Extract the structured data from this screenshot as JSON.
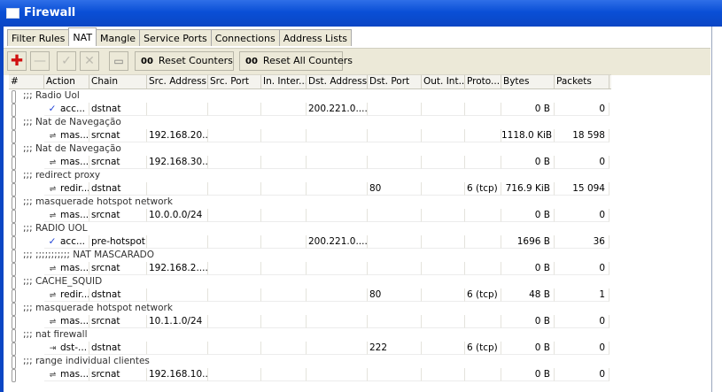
{
  "window": {
    "title": "Firewall"
  },
  "tabs": [
    "Filter Rules",
    "NAT",
    "Mangle",
    "Service Ports",
    "Connections",
    "Address Lists"
  ],
  "active_tab": "NAT",
  "toolbar": {
    "reset_counters": "Reset Counters",
    "reset_all_counters": "Reset All Counters",
    "counter_glyph": "00"
  },
  "columns": [
    "#",
    "Action",
    "Chain",
    "Src. Address",
    "Src. Port",
    "In. Inter...",
    "Dst. Address",
    "Dst. Port",
    "Out. Int...",
    "Proto...",
    "Bytes",
    "Packets"
  ],
  "rows": [
    {
      "comment": ";;; Radio Uol"
    },
    {
      "action_icon": "accept-icon",
      "action": "acc...",
      "chain": "dstnat",
      "src": "",
      "src_port": "",
      "in": "",
      "dst": "200.221.0....",
      "dst_port": "",
      "out": "",
      "proto": "",
      "bytes": "0 B",
      "packets": "0"
    },
    {
      "comment": ";;; Nat de Navegação"
    },
    {
      "action_icon": "masquerade-icon",
      "action": "mas...",
      "chain": "srcnat",
      "src": "192.168.20...",
      "src_port": "",
      "in": "",
      "dst": "",
      "dst_port": "",
      "out": "",
      "proto": "",
      "bytes": "1118.0 KiB",
      "packets": "18 598"
    },
    {
      "comment": ";;; Nat de Navegação"
    },
    {
      "action_icon": "masquerade-icon",
      "action": "mas...",
      "chain": "srcnat",
      "src": "192.168.30...",
      "src_port": "",
      "in": "",
      "dst": "",
      "dst_port": "",
      "out": "",
      "proto": "",
      "bytes": "0 B",
      "packets": "0"
    },
    {
      "comment": ";;; redirect proxy"
    },
    {
      "action_icon": "masquerade-icon",
      "action": "redir...",
      "chain": "dstnat",
      "src": "",
      "src_port": "",
      "in": "",
      "dst": "",
      "dst_port": "80",
      "out": "",
      "proto": "6 (tcp)",
      "bytes": "716.9 KiB",
      "packets": "15 094"
    },
    {
      "comment": ";;; masquerade hotspot network"
    },
    {
      "action_icon": "masquerade-icon",
      "action": "mas...",
      "chain": "srcnat",
      "src": "10.0.0.0/24",
      "src_port": "",
      "in": "",
      "dst": "",
      "dst_port": "",
      "out": "",
      "proto": "",
      "bytes": "0 B",
      "packets": "0"
    },
    {
      "comment": ";;; RADIO UOL"
    },
    {
      "action_icon": "accept-icon",
      "action": "acc...",
      "chain": "pre-hotspot",
      "src": "",
      "src_port": "",
      "in": "",
      "dst": "200.221.0....",
      "dst_port": "",
      "out": "",
      "proto": "",
      "bytes": "1696 B",
      "packets": "36"
    },
    {
      "comment": ";;; ;;;;;;;;;;; NAT MASCARADO"
    },
    {
      "action_icon": "masquerade-icon",
      "action": "mas...",
      "chain": "srcnat",
      "src": "192.168.2....",
      "src_port": "",
      "in": "",
      "dst": "",
      "dst_port": "",
      "out": "",
      "proto": "",
      "bytes": "0 B",
      "packets": "0"
    },
    {
      "comment": ";;; CACHE_SQUID"
    },
    {
      "action_icon": "masquerade-icon",
      "action": "redir...",
      "chain": "dstnat",
      "src": "",
      "src_port": "",
      "in": "",
      "dst": "",
      "dst_port": "80",
      "out": "",
      "proto": "6 (tcp)",
      "bytes": "48 B",
      "packets": "1"
    },
    {
      "comment": ";;; masquerade hotspot network"
    },
    {
      "action_icon": "masquerade-icon",
      "action": "mas...",
      "chain": "srcnat",
      "src": "10.1.1.0/24",
      "src_port": "",
      "in": "",
      "dst": "",
      "dst_port": "",
      "out": "",
      "proto": "",
      "bytes": "0 B",
      "packets": "0"
    },
    {
      "comment": ";;; nat firewall"
    },
    {
      "action_icon": "dst-nat-icon",
      "action": "dst-...",
      "chain": "dstnat",
      "src": "",
      "src_port": "",
      "in": "",
      "dst": "",
      "dst_port": "222",
      "out": "",
      "proto": "6 (tcp)",
      "bytes": "0 B",
      "packets": "0"
    },
    {
      "comment": ";;; range individual clientes"
    },
    {
      "action_icon": "masquerade-icon",
      "action": "mas...",
      "chain": "srcnat",
      "src": "192.168.10...",
      "src_port": "",
      "in": "",
      "dst": "",
      "dst_port": "",
      "out": "",
      "proto": "",
      "bytes": "0 B",
      "packets": "0"
    }
  ]
}
